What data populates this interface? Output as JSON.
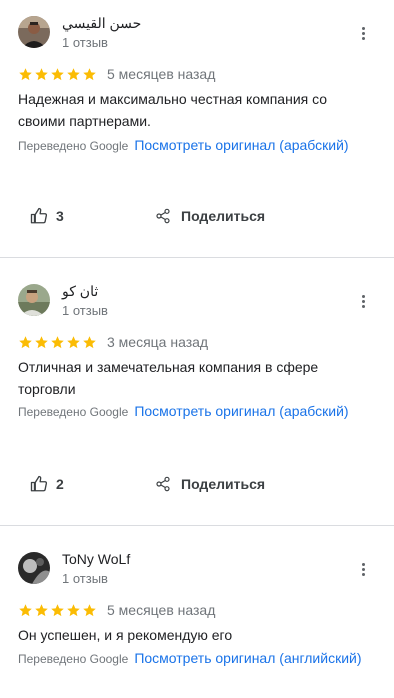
{
  "reviews": [
    {
      "reviewer_name": "حسن القيسي",
      "review_count": "1 отзыв",
      "stars": 5,
      "time_ago": "5 месяцев назад",
      "text": "Надежная и максимально честная компания со своими партнерами.",
      "translated_label": "Переведено Google",
      "view_original": "Посмотреть оригинал",
      "original_language": "(арабский)",
      "likes": "3",
      "share_label": "Поделиться"
    },
    {
      "reviewer_name": "ثان كو",
      "review_count": "1 отзыв",
      "stars": 5,
      "time_ago": "3 месяца назад",
      "text": "Отличная и замечательная компания в сфере торговли",
      "translated_label": "Переведено Google",
      "view_original": "Посмотреть оригинал",
      "original_language": "(арабский)",
      "likes": "2",
      "share_label": "Поделиться"
    },
    {
      "reviewer_name": "ToNy WoLf",
      "review_count": "1 отзыв",
      "stars": 5,
      "time_ago": "5 месяцев назад",
      "text": "Он успешен, и я рекомендую его",
      "translated_label": "Переведено Google",
      "view_original": "Посмотреть оригинал",
      "original_language": "(английский)"
    }
  ],
  "colors": {
    "star": "#fbbc04",
    "link": "#1a73e8",
    "muted": "#70757a",
    "divider": "#dadce0"
  },
  "icons": {
    "star": "star-icon",
    "more": "more-vert-icon",
    "like": "thumb-up-icon",
    "share": "share-icon"
  }
}
